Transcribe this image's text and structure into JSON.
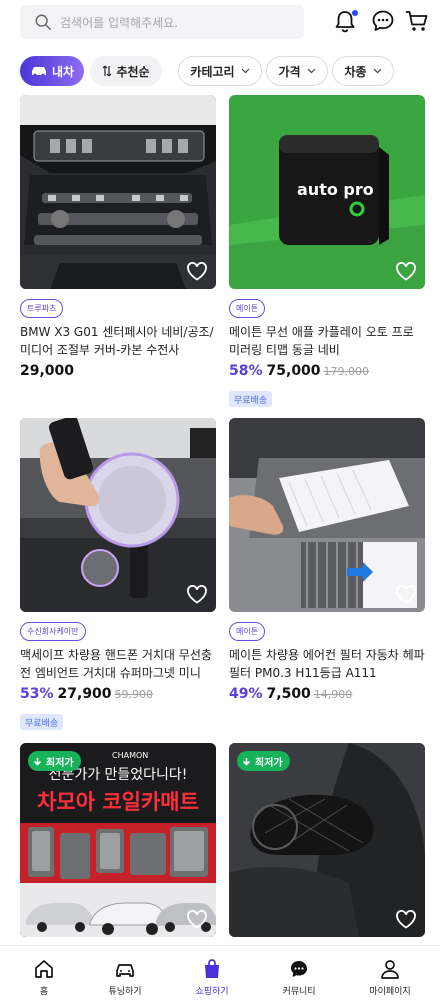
{
  "search": {
    "placeholder": "검색어를 입력해주세요."
  },
  "header_icons": [
    "bell-icon",
    "chat-icon",
    "cart-icon"
  ],
  "filters": {
    "car": "내차",
    "sort": "추천순",
    "category": "카테고리",
    "price": "가격",
    "car_type": "차종"
  },
  "products": [
    {
      "tag": "트루파츠",
      "title": "BMW X3 G01 센터페시아 네비/공조/미디어 조절부 커버-카본 수전사",
      "discount": "",
      "price": "29,000",
      "original": "",
      "shipping": ""
    },
    {
      "tag": "메이튼",
      "title": "메이튼 무선 애플 카플레이 오토 프로 미러링 티맵 동글 네비",
      "discount": "58%",
      "price": "75,000",
      "original": "179,000",
      "shipping": "무료배송",
      "image_text": "auto pro"
    },
    {
      "tag": "수신회사케이만",
      "title": "맥세이프 차량용 핸드폰 거치대 무선충전 엠비언트 거치대 슈퍼마그넷 미니",
      "discount": "53%",
      "price": "27,900",
      "original": "59,900",
      "shipping": "무료배송"
    },
    {
      "tag": "메이튼",
      "title": "메이튼 차량용 에어컨 필터 자동차 헤파필터 PM0.3 H11등급 A111",
      "discount": "49%",
      "price": "7,500",
      "original": "14,900",
      "shipping": ""
    },
    {
      "badge": "최저가",
      "image_text": {
        "brand": "CHAMON",
        "slogan": "전문가가 만들었다니다!",
        "headline": "차모아 코일카매트"
      }
    },
    {
      "badge": "최저가"
    }
  ],
  "nav": [
    {
      "label": "홈",
      "icon": "home-icon"
    },
    {
      "label": "튜닝하기",
      "icon": "car-icon"
    },
    {
      "label": "쇼핑하기",
      "icon": "shopping-bag-icon",
      "active": true
    },
    {
      "label": "커뮤니티",
      "icon": "chat-icon"
    },
    {
      "label": "마이페이지",
      "icon": "person-icon"
    }
  ],
  "colors": {
    "accent": "#5b3de0",
    "best": "#17b35a",
    "free_ship_bg": "#dfe7ff"
  }
}
